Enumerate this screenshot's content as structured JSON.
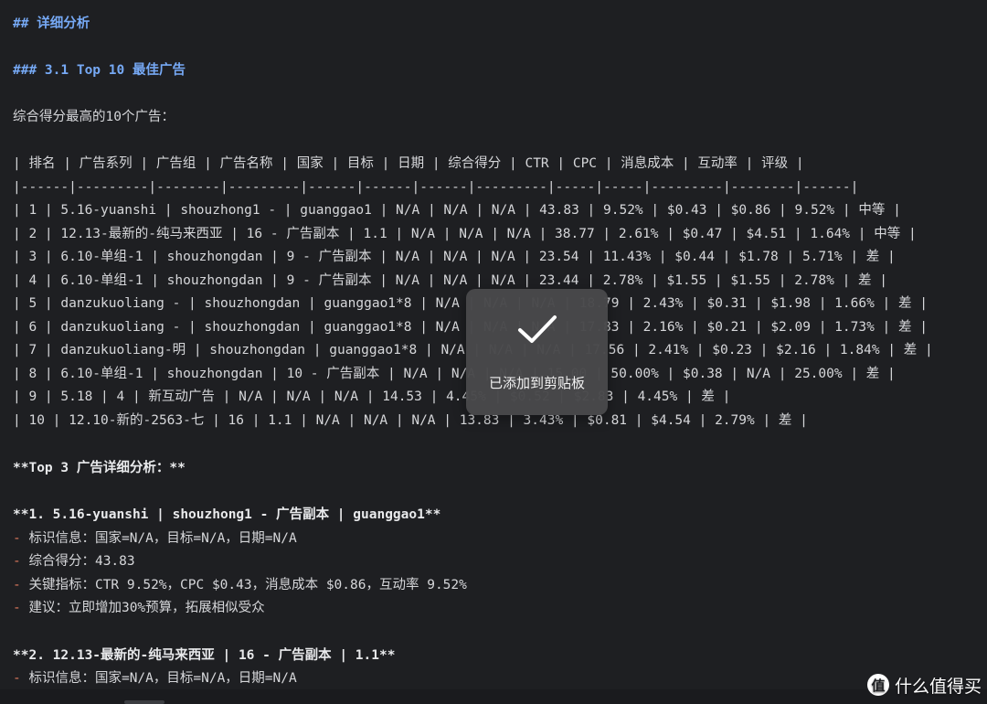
{
  "doc": {
    "h2": "## 详细分析",
    "h3": "### 3.1 Top 10 最佳广告",
    "intro": "综合得分最高的10个广告：",
    "table_header": "| 排名 | 广告系列 | 广告组 | 广告名称 | 国家 | 目标 | 日期 | 综合得分 | CTR | CPC | 消息成本 | 互动率 | 评级 |",
    "table_sep": "|------|---------|--------|---------|------|------|------|---------|-----|-----|---------|--------|------|",
    "rows": [
      "| 1 | 5.16-yuanshi | shouzhong1 - | guanggao1 | N/A | N/A | N/A | 43.83 | 9.52% | $0.43 | $0.86 | 9.52% | 中等 |",
      "| 2 | 12.13-最新的-纯马来西亚 | 16 - 广告副本 | 1.1 | N/A | N/A | N/A | 38.77 | 2.61% | $0.47 | $4.51 | 1.64% | 中等 |",
      "| 3 | 6.10-单组-1 | shouzhongdan | 9 - 广告副本 | N/A | N/A | N/A | 23.54 | 11.43% | $0.44 | $1.78 | 5.71% | 差 |",
      "| 4 | 6.10-单组-1 | shouzhongdan | 9 - 广告副本 | N/A | N/A | N/A | 23.44 | 2.78% | $1.55 | $1.55 | 2.78% | 差 |",
      "| 5 | danzukuoliang - | shouzhongdan | guanggao1*8 | N/A | N/A | N/A | 18.79 | 2.43% | $0.31 | $1.98 | 1.66% | 差 |",
      "| 6 | danzukuoliang - | shouzhongdan | guanggao1*8 | N/A | N/A | N/A | 17.83 | 2.16% | $0.21 | $2.09 | 1.73% | 差 |",
      "| 7 | danzukuoliang-明 | shouzhongdan | guanggao1*8 | N/A | N/A | N/A | 17.56 | 2.41% | $0.23 | $2.16 | 1.84% | 差 |",
      "| 8 | 6.10-单组-1 | shouzhongdan | 10 - 广告副本 | N/A | N/A | N/A | 15.00 | 50.00% | $0.38 | N/A | 25.00% | 差 |",
      "| 9 | 5.18 | 4 | 新互动广告 | N/A | N/A | N/A | 14.53 | 4.45% | $0.52 | $2.83 | 4.45% | 差 |",
      "| 10 | 12.10-新的-2563-七 | 16 | 1.1 | N/A | N/A | N/A | 13.83 | 3.43% | $0.81 | $4.54 | 2.79% | 差 |"
    ],
    "top3_title": "**Top 3 广告详细分析：**",
    "ad1_title": "**1. 5.16-yuanshi | shouzhong1 - 广告副本 | guanggao1**",
    "ad1_items": [
      "标识信息：国家=N/A，目标=N/A，日期=N/A",
      "综合得分：43.83",
      "关键指标：CTR 9.52%，CPC $0.43，消息成本 $0.86，互动率 9.52%",
      "建议：立即增加30%预算，拓展相似受众"
    ],
    "ad2_title": "**2. 12.13-最新的-纯马来西亚 | 16 - 广告副本 | 1.1**",
    "ad2_items": [
      "标识信息：国家=N/A，目标=N/A，日期=N/A"
    ],
    "dash": "- "
  },
  "toast": {
    "text": "已添加到剪贴板",
    "icon": "check-icon"
  },
  "watermark": {
    "text": "什么值得买",
    "logo_glyph": "值"
  },
  "colors": {
    "background": "#1e1f22",
    "heading": "#76a9f5",
    "list_dash": "#e07a5f",
    "toast": "#48484a"
  }
}
